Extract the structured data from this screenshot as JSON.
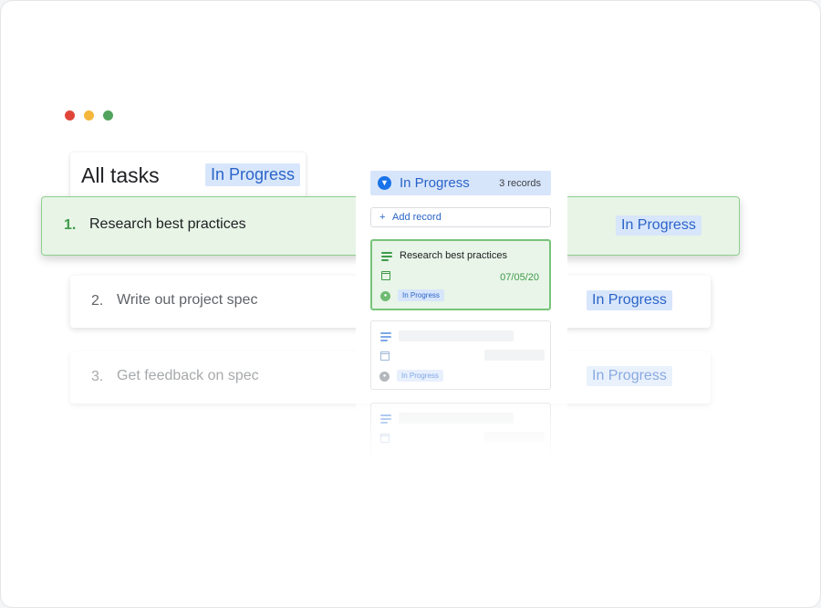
{
  "window_controls": [
    "red-dot",
    "yellow-dot",
    "green-dot"
  ],
  "header": {
    "title": "All tasks",
    "status_badge": "In Progress"
  },
  "tasks": [
    {
      "number": "1.",
      "label": "Research best practices",
      "status": "In Progress"
    },
    {
      "number": "2.",
      "label": "Write out project spec",
      "status": "In Progress"
    },
    {
      "number": "3.",
      "label": "Get feedback on spec",
      "status": "In Progress"
    }
  ],
  "panel": {
    "group": {
      "title": "In Progress",
      "count": "3 records",
      "icon": "chevron-down-icon"
    },
    "add_record": {
      "icon": "plus",
      "label": "Add record"
    },
    "records": [
      {
        "title": "Research best practices",
        "date": "07/05/20",
        "status": "In Progress"
      },
      {
        "title": "",
        "date": "",
        "status": "In Progress"
      },
      {
        "title": "",
        "date": "",
        "status": ""
      }
    ]
  },
  "colors": {
    "accent_blue": "#1a73e8",
    "badge_bg": "#d8e6fb",
    "badge_text": "#2a64c8",
    "selected_green": "#3f9a49",
    "selected_bg": "#e7f4e6"
  }
}
